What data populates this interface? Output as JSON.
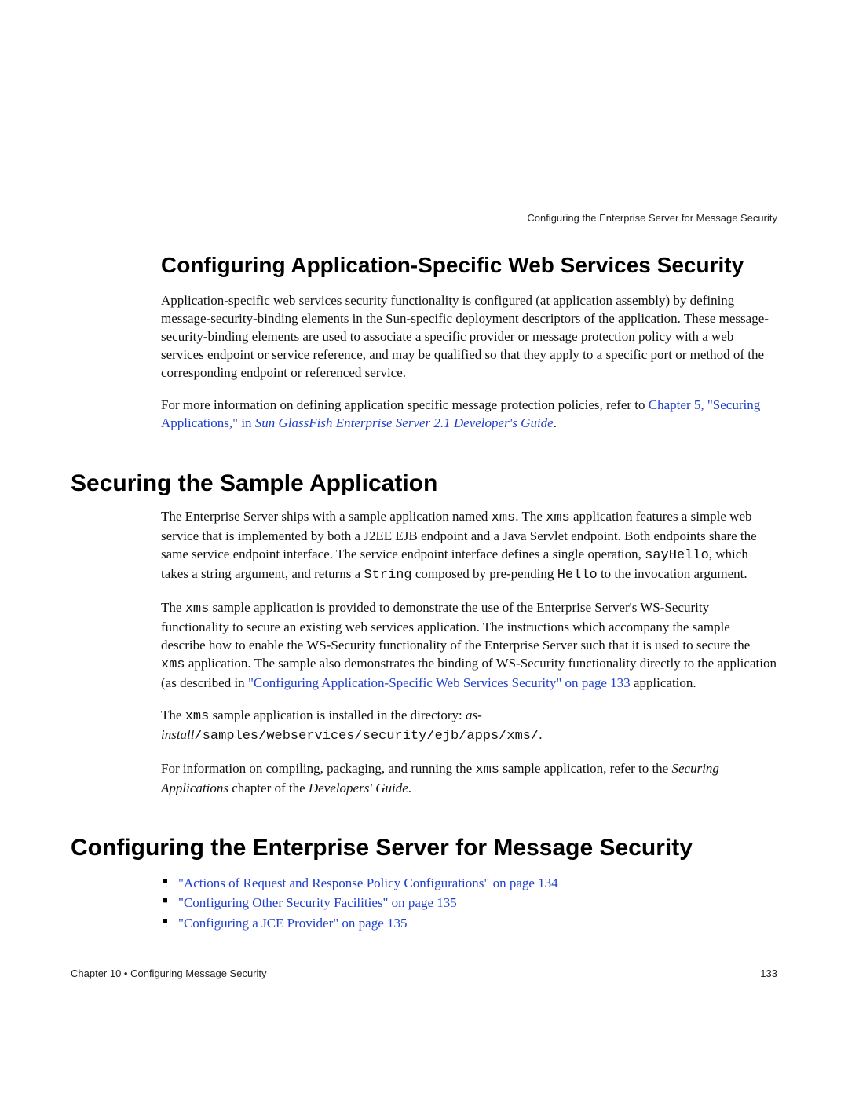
{
  "runningHead": "Configuring the Enterprise Server for Message Security",
  "sec1": {
    "title": "Configuring Application-Specific Web Services Security",
    "p1": "Application-specific web services security functionality is configured (at application assembly) by defining message-security-binding elements in the Sun-specific deployment descriptors of the application. These message-security-binding elements are used to associate a specific provider or message protection policy with a web services endpoint or service reference, and may be qualified so that they apply to a specific port or method of the corresponding endpoint or referenced service.",
    "p2_a": "For more information on defining application specific message protection policies, refer to ",
    "p2_link_a": "Chapter 5, \"Securing Applications,\" in ",
    "p2_link_b": "Sun GlassFish Enterprise Server 2.1 Developer's Guide",
    "p2_c": "."
  },
  "sec2": {
    "title": "Securing the Sample Application",
    "p1_a": "The Enterprise Server ships with a sample application named ",
    "p1_b": ". The ",
    "p1_c": " application features a simple web service that is implemented by both a J2EE EJB endpoint and a Java Servlet endpoint. Both endpoints share the same service endpoint interface. The service endpoint interface defines a single operation, ",
    "p1_d": ", which takes a string argument, and returns a ",
    "p1_e": " composed by pre-pending ",
    "p1_f": " to the invocation argument.",
    "xms": "xms",
    "sayHello": "sayHello",
    "String": "String",
    "Hello": "Hello",
    "p2_a": "The ",
    "p2_b": " sample application is provided to demonstrate the use of the Enterprise Server's WS-Security functionality to secure an existing web services application. The instructions which accompany the sample describe how to enable the WS-Security functionality of the Enterprise Server such that it is used to secure the ",
    "p2_c": " application. The sample also demonstrates the binding of WS-Security functionality directly to the application (as described in ",
    "p2_link": "\"Configuring Application-Specific Web Services Security\" on page 133",
    "p2_d": " application.",
    "p3_a": "The ",
    "p3_b": " sample application is installed in the directory: ",
    "p3_path_a": "as-install",
    "p3_path_b": "/samples/webservices/security/ejb/apps/xms/",
    "p3_c": ".",
    "p4_a": "For information on compiling, packaging, and running the ",
    "p4_b": " sample application, refer to the ",
    "p4_c": "Securing Applications",
    "p4_d": " chapter of the ",
    "p4_e": "Developers' Guide",
    "p4_f": "."
  },
  "sec3": {
    "title": "Configuring the Enterprise Server for Message Security",
    "items": [
      "\"Actions of Request and Response Policy Configurations\" on page 134",
      "\"Configuring Other Security Facilities\" on page 135",
      "\"Configuring a JCE Provider\" on page 135"
    ]
  },
  "footer": {
    "left": "Chapter 10 • Configuring Message Security",
    "right": "133"
  }
}
